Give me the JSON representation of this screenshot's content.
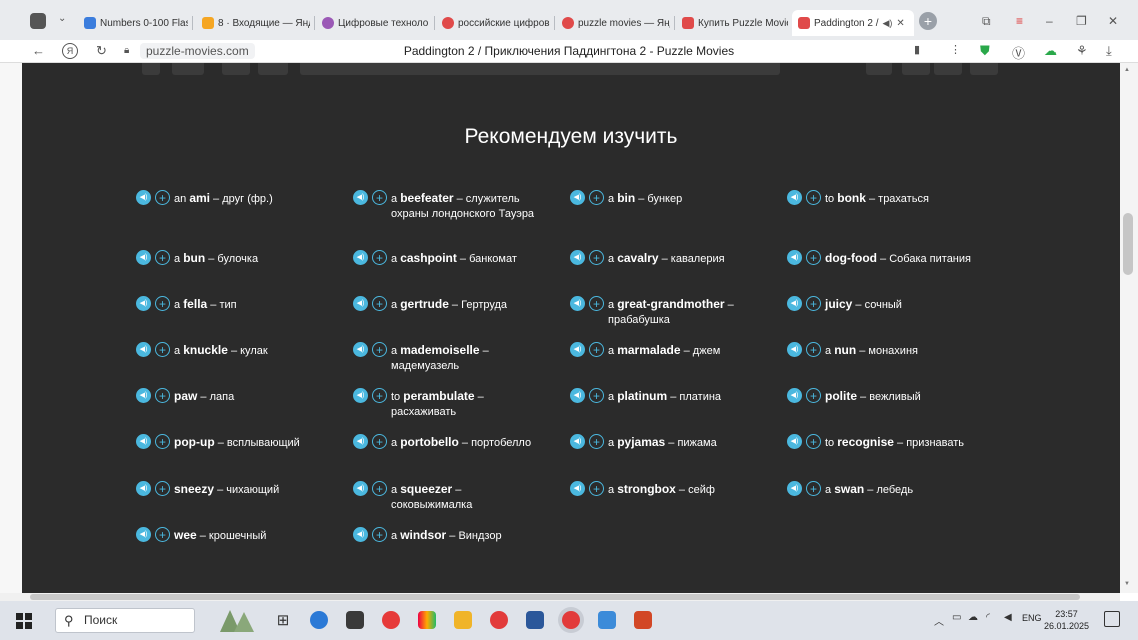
{
  "browser": {
    "tabs": [
      {
        "label": "Numbers 0-100 Flas",
        "color": "#3b7ddd"
      },
      {
        "label": "8 · Входящие — Янд",
        "color": "#f5a623"
      },
      {
        "label": "Цифровые техноло",
        "color": "#9b59b6"
      },
      {
        "label": "российские цифров",
        "color": "#e04a4a"
      },
      {
        "label": "puzzle movies — Янд",
        "color": "#e04a4a"
      },
      {
        "label": "Купить Puzzle Movie",
        "color": "#e04a4a"
      },
      {
        "label": "Paddington 2 /",
        "color": "#e04a4a"
      }
    ],
    "domain": "puzzle-movies.com",
    "page_title": "Paddington 2 / Приключения Паддингтона 2 - Puzzle Movies"
  },
  "page": {
    "heading": "Рекомендуем изучить",
    "words": [
      {
        "article": "an",
        "word": "ami",
        "translation": "друг (фр.)"
      },
      {
        "article": "a",
        "word": "beefeater",
        "translation": "служитель охраны лондонского Тауэра"
      },
      {
        "article": "a",
        "word": "bin",
        "translation": "бункер"
      },
      {
        "article": "to",
        "word": "bonk",
        "translation": "трахаться"
      },
      {
        "article": "a",
        "word": "bun",
        "translation": "булочка"
      },
      {
        "article": "a",
        "word": "cashpoint",
        "translation": "банкомат"
      },
      {
        "article": "a",
        "word": "cavalry",
        "translation": "кавалерия"
      },
      {
        "article": "",
        "word": "dog-food",
        "translation": "Собака питания"
      },
      {
        "article": "a",
        "word": "fella",
        "translation": "тип"
      },
      {
        "article": "a",
        "word": "gertrude",
        "translation": "Гертруда"
      },
      {
        "article": "a",
        "word": "great-grandmother",
        "translation": "прабабушка"
      },
      {
        "article": "",
        "word": "juicy",
        "translation": "сочный"
      },
      {
        "article": "a",
        "word": "knuckle",
        "translation": "кулак"
      },
      {
        "article": "a",
        "word": "mademoiselle",
        "translation": "мадемуазель"
      },
      {
        "article": "a",
        "word": "marmalade",
        "translation": "джем"
      },
      {
        "article": "a",
        "word": "nun",
        "translation": "монахиня"
      },
      {
        "article": "",
        "word": "paw",
        "translation": "лапа"
      },
      {
        "article": "to",
        "word": "perambulate",
        "translation": "расхаживать"
      },
      {
        "article": "a",
        "word": "platinum",
        "translation": "платина"
      },
      {
        "article": "",
        "word": "polite",
        "translation": "вежливый"
      },
      {
        "article": "",
        "word": "pop-up",
        "translation": "всплывающий"
      },
      {
        "article": "a",
        "word": "portobello",
        "translation": "портобелло"
      },
      {
        "article": "a",
        "word": "pyjamas",
        "translation": "пижама"
      },
      {
        "article": "to",
        "word": "recognise",
        "translation": "признавать"
      },
      {
        "article": "",
        "word": "sneezy",
        "translation": "чихающий"
      },
      {
        "article": "a",
        "word": "squeezer",
        "translation": "соковыжималка"
      },
      {
        "article": "a",
        "word": "strongbox",
        "translation": "сейф"
      },
      {
        "article": "a",
        "word": "swan",
        "translation": "лебедь"
      },
      {
        "article": "",
        "word": "wee",
        "translation": "крошечный"
      },
      {
        "article": "a",
        "word": "windsor",
        "translation": "Виндзор"
      }
    ]
  },
  "taskbar": {
    "search_placeholder": "Поиск",
    "lang": "ENG",
    "time": "23:57",
    "date": "26.01.2025"
  }
}
